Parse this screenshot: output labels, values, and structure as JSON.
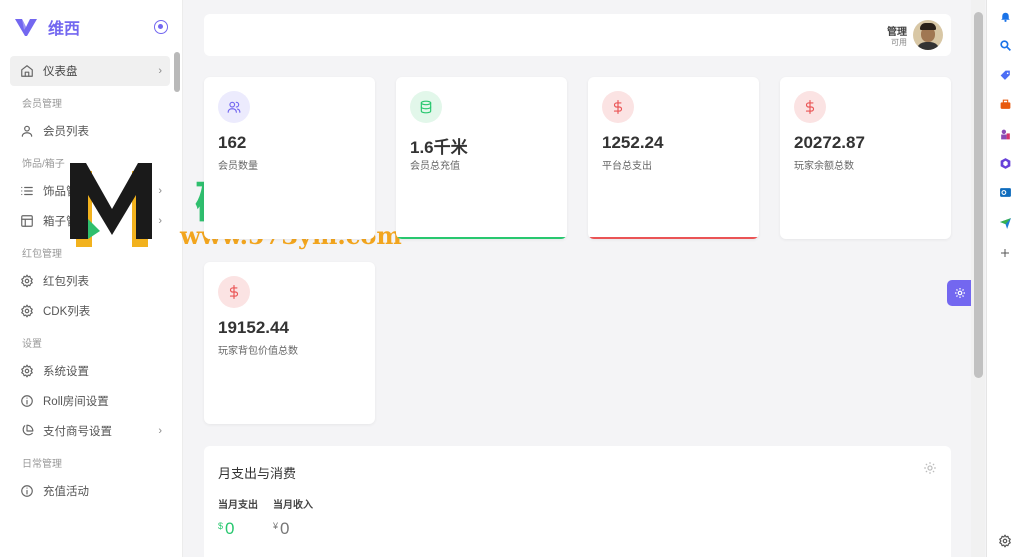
{
  "brand": {
    "name": "维西"
  },
  "sidebar": {
    "items": [
      {
        "type": "item",
        "label": "仪表盘",
        "icon": "home-icon",
        "active": true,
        "arrow": true
      },
      {
        "type": "header",
        "label": "会员管理"
      },
      {
        "type": "item",
        "label": "会员列表",
        "icon": "user-icon"
      },
      {
        "type": "header",
        "label": "饰品/箱子"
      },
      {
        "type": "item",
        "label": "饰品管",
        "icon": "list-icon",
        "arrow": true
      },
      {
        "type": "item",
        "label": "箱子管",
        "icon": "layout-icon",
        "arrow": true
      },
      {
        "type": "header",
        "label": "红包管理"
      },
      {
        "type": "item",
        "label": "红包列表",
        "icon": "gear-icon"
      },
      {
        "type": "item",
        "label": "CDK列表",
        "icon": "gear-icon"
      },
      {
        "type": "header",
        "label": "设置"
      },
      {
        "type": "item",
        "label": "系统设置",
        "icon": "gear-icon"
      },
      {
        "type": "item",
        "label": "Roll房间设置",
        "icon": "info-icon"
      },
      {
        "type": "item",
        "label": "支付商号设置",
        "icon": "pie-chart-icon",
        "arrow": true
      },
      {
        "type": "header",
        "label": "日常管理"
      },
      {
        "type": "item",
        "label": "充值活动",
        "icon": "info-icon"
      }
    ]
  },
  "watermark": {
    "cn": "码之家",
    "url": "www.573ym.com"
  },
  "topbar": {
    "user_name": "管理",
    "user_status": "可用"
  },
  "stats": [
    {
      "value": "162",
      "label": "会员数量",
      "icon": "users-icon",
      "color": "purple",
      "bar": ""
    },
    {
      "value": "1.6千米",
      "label": "会员总充值",
      "icon": "database-icon",
      "color": "green",
      "bar": "#28c76f"
    },
    {
      "value": "1252.24",
      "label": "平台总支出",
      "icon": "dollar-icon",
      "color": "red",
      "bar": "#ea5455"
    },
    {
      "value": "20272.87",
      "label": "玩家余额总数",
      "icon": "dollar-icon",
      "color": "red",
      "bar": ""
    },
    {
      "value": "19152.44",
      "label": "玩家背包价值总数",
      "icon": "dollar-icon",
      "color": "red",
      "bar": ""
    }
  ],
  "monthly": {
    "title": "月支出与消费",
    "expense_label": "当月支出",
    "expense_currency": "$",
    "expense_value": "0",
    "income_label": "当月收入",
    "income_currency": "¥",
    "income_value": "0"
  },
  "colors": {
    "accent": "#7367f0",
    "success": "#28c76f",
    "danger": "#ea5455"
  },
  "right_toolbar": [
    "bell-icon",
    "search-icon",
    "tag-icon",
    "toolbox-icon",
    "chess-icon",
    "office-icon",
    "outlook-icon",
    "send-icon",
    "plus-icon",
    "settings-icon"
  ]
}
